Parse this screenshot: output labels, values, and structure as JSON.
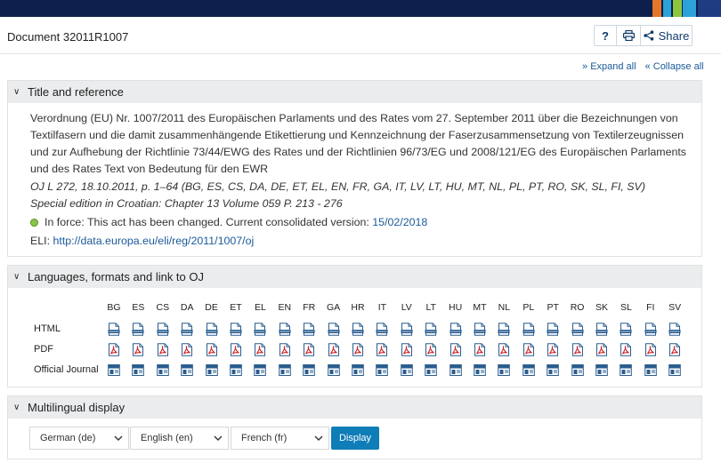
{
  "topbar": {
    "colors": [
      "#0e1f4d",
      "#e4762a",
      "#2da1d9",
      "#8cc63f",
      "#1f3c82"
    ]
  },
  "document": {
    "title": "Document 32011R1007"
  },
  "toolbar": {
    "help_label": "?",
    "share_label": "Share",
    "icons": [
      "help-icon",
      "print-icon",
      "share-icon"
    ]
  },
  "expand": {
    "expand_all": "Expand all",
    "collapse_all": "Collapse all"
  },
  "title_panel": {
    "heading": "Title and reference",
    "title_text": "Verordnung (EU) Nr. 1007/2011 des Europäischen Parlaments und des Rates vom 27. September 2011 über die Bezeichnungen von Textilfasern und die damit zusammenhängende Etikettierung und Kennzeichnung der Faserzusammensetzung von Textilerzeugnissen und zur Aufhebung der Richtlinie 73/44/EWG des Rates und der Richtlinien 96/73/EG und 2008/121/EG des Europäischen Parlaments und des Rates Text von Bedeutung für den EWR",
    "oj_reference": "OJ L 272, 18.10.2011, p. 1–64 (BG, ES, CS, DA, DE, ET, EL, EN, FR, GA, IT, LV, LT, HU, MT, NL, PL, PT, RO, SK, SL, FI, SV)",
    "special_edition": "Special edition in Croatian: Chapter 13 Volume 059 P. 213 - 276",
    "status_text": "In force: This act has been changed. Current consolidated version:",
    "status_date": "15/02/2018",
    "status_color": "#8bc34a",
    "eli_label": "ELI:",
    "eli_url": "http://data.europa.eu/eli/reg/2011/1007/oj"
  },
  "lang_panel": {
    "heading": "Languages, formats and link to OJ",
    "languages": [
      "BG",
      "ES",
      "CS",
      "DA",
      "DE",
      "ET",
      "EL",
      "EN",
      "FR",
      "GA",
      "HR",
      "IT",
      "LV",
      "LT",
      "HU",
      "MT",
      "NL",
      "PL",
      "PT",
      "RO",
      "SK",
      "SL",
      "FI",
      "SV"
    ],
    "rows": [
      {
        "label": "HTML",
        "icon": "html-file-icon"
      },
      {
        "label": "PDF",
        "icon": "pdf-file-icon"
      },
      {
        "label": "Official Journal",
        "icon": "official-journal-icon"
      }
    ]
  },
  "multi_panel": {
    "heading": "Multilingual display",
    "selects": [
      {
        "value": "German (de)"
      },
      {
        "value": "English (en)"
      },
      {
        "value": "French (fr)"
      }
    ],
    "display_label": "Display"
  }
}
